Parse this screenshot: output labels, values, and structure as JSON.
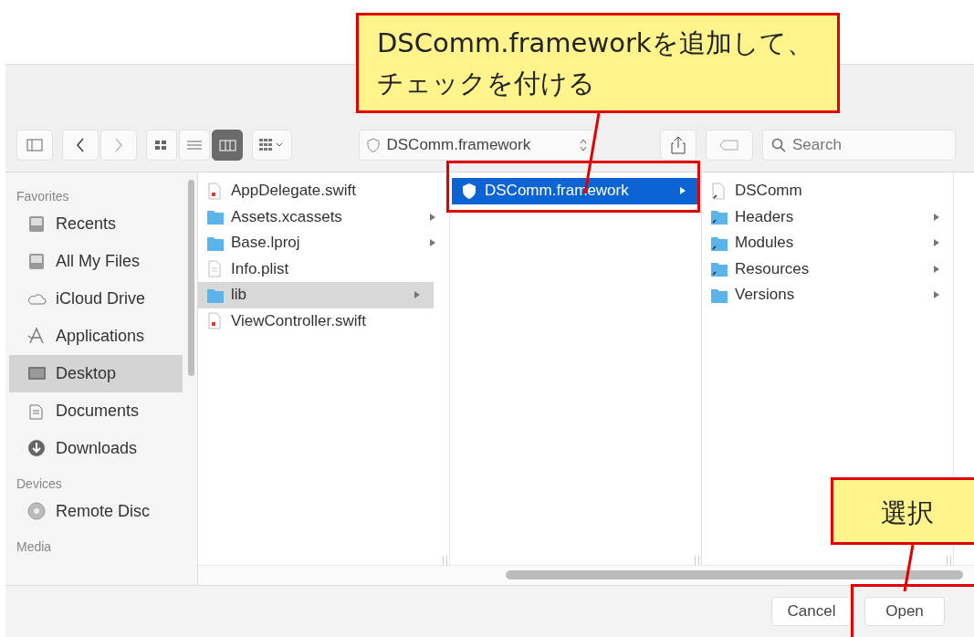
{
  "toolbar": {
    "view_modes": [
      {
        "selected": false
      },
      {
        "selected": false
      },
      {
        "selected": true
      }
    ],
    "path": "DSComm.framework",
    "search": {
      "placeholder": "Search"
    }
  },
  "sidebar": {
    "sections": [
      {
        "title": "Favorites",
        "items": [
          {
            "label": "Recents",
            "selected": false
          },
          {
            "label": "All My Files",
            "selected": false
          },
          {
            "label": "iCloud Drive",
            "selected": false
          },
          {
            "label": "Applications",
            "selected": false
          },
          {
            "label": "Desktop",
            "selected": true
          },
          {
            "label": "Documents",
            "selected": false
          },
          {
            "label": "Downloads",
            "selected": false
          }
        ]
      },
      {
        "title": "Devices",
        "items": [
          {
            "label": "Remote Disc",
            "selected": false
          }
        ]
      },
      {
        "title": "Media"
      }
    ]
  },
  "columns": [
    {
      "focused": false,
      "items": [
        {
          "name": "AppDelegate.swift",
          "kind": "swift",
          "has_children": false,
          "selected": false
        },
        {
          "name": "Assets.xcassets",
          "kind": "folder",
          "has_children": true,
          "selected": false
        },
        {
          "name": "Base.lproj",
          "kind": "folder",
          "has_children": true,
          "selected": false
        },
        {
          "name": "Info.plist",
          "kind": "file",
          "has_children": false,
          "selected": false
        },
        {
          "name": "lib",
          "kind": "folder",
          "has_children": true,
          "selected": true
        },
        {
          "name": "ViewController.swift",
          "kind": "swift",
          "has_children": false,
          "selected": false
        }
      ]
    },
    {
      "focused": true,
      "items": [
        {
          "name": "DSComm.framework",
          "kind": "framework",
          "has_children": true,
          "selected": true
        }
      ]
    },
    {
      "focused": false,
      "items": [
        {
          "name": "DSComm",
          "kind": "alias",
          "has_children": false,
          "selected": false
        },
        {
          "name": "Headers",
          "kind": "aliasfolder",
          "has_children": true,
          "selected": false
        },
        {
          "name": "Modules",
          "kind": "aliasfolder",
          "has_children": true,
          "selected": false
        },
        {
          "name": "Resources",
          "kind": "aliasfolder",
          "has_children": true,
          "selected": false
        },
        {
          "name": "Versions",
          "kind": "folder",
          "has_children": true,
          "selected": false
        }
      ]
    }
  ],
  "buttons": [
    {
      "label": "Cancel"
    },
    {
      "label": "Open"
    }
  ],
  "callouts": [
    {
      "lines": [
        "DSComm.frameworkを追加して、",
        "チェックを付ける"
      ]
    },
    {
      "lines": [
        "選択"
      ]
    }
  ]
}
